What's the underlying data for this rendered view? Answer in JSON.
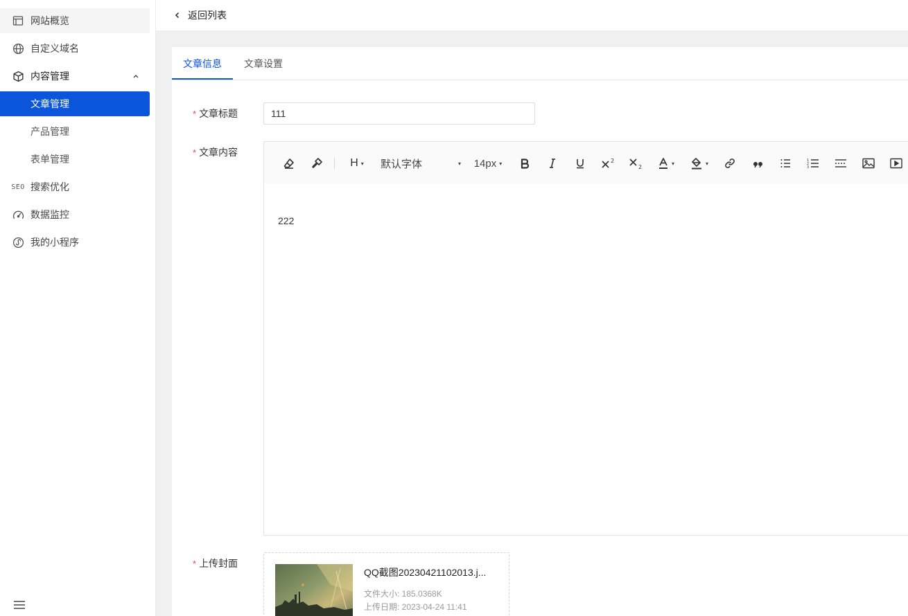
{
  "sidebar": {
    "items": [
      {
        "label": "网站概览",
        "icon": "browser-window-icon"
      },
      {
        "label": "自定义域名",
        "icon": "globe-icon"
      },
      {
        "label": "内容管理",
        "icon": "box-icon"
      },
      {
        "label": "搜索优化",
        "icon": "seo-icon"
      },
      {
        "label": "数据监控",
        "icon": "gauge-icon"
      },
      {
        "label": "我的小程序",
        "icon": "mini-program-icon"
      }
    ],
    "seo_badge": "SEO",
    "sub_items": [
      "文章管理",
      "产品管理",
      "表单管理"
    ],
    "active_sub": "文章管理",
    "accent": "#0b55db"
  },
  "topbar": {
    "back_label": "返回列表"
  },
  "tabs": [
    {
      "label": "文章信息",
      "active": true
    },
    {
      "label": "文章设置",
      "active": false
    }
  ],
  "form": {
    "required_mark": "*",
    "title_label": "文章标题",
    "title_value": "111",
    "content_label": "文章内容",
    "cover_label": "上传封面"
  },
  "editor": {
    "heading_label": "H",
    "font_family": "默认字体",
    "font_size": "14px",
    "body_text": "222",
    "tools": [
      "clear-format",
      "format-painter",
      "heading",
      "font-family",
      "font-size",
      "bold",
      "italic",
      "underline",
      "superscript",
      "subscript",
      "font-color",
      "background-color",
      "link",
      "quote",
      "bullet-list",
      "numbered-list",
      "horizontal-rule",
      "image",
      "video"
    ]
  },
  "upload": {
    "file_name": "QQ截图20230421102013.j...",
    "file_size": "文件大小: 185.0368K",
    "upload_date": "上传日期: 2023-04-24 11:41"
  }
}
